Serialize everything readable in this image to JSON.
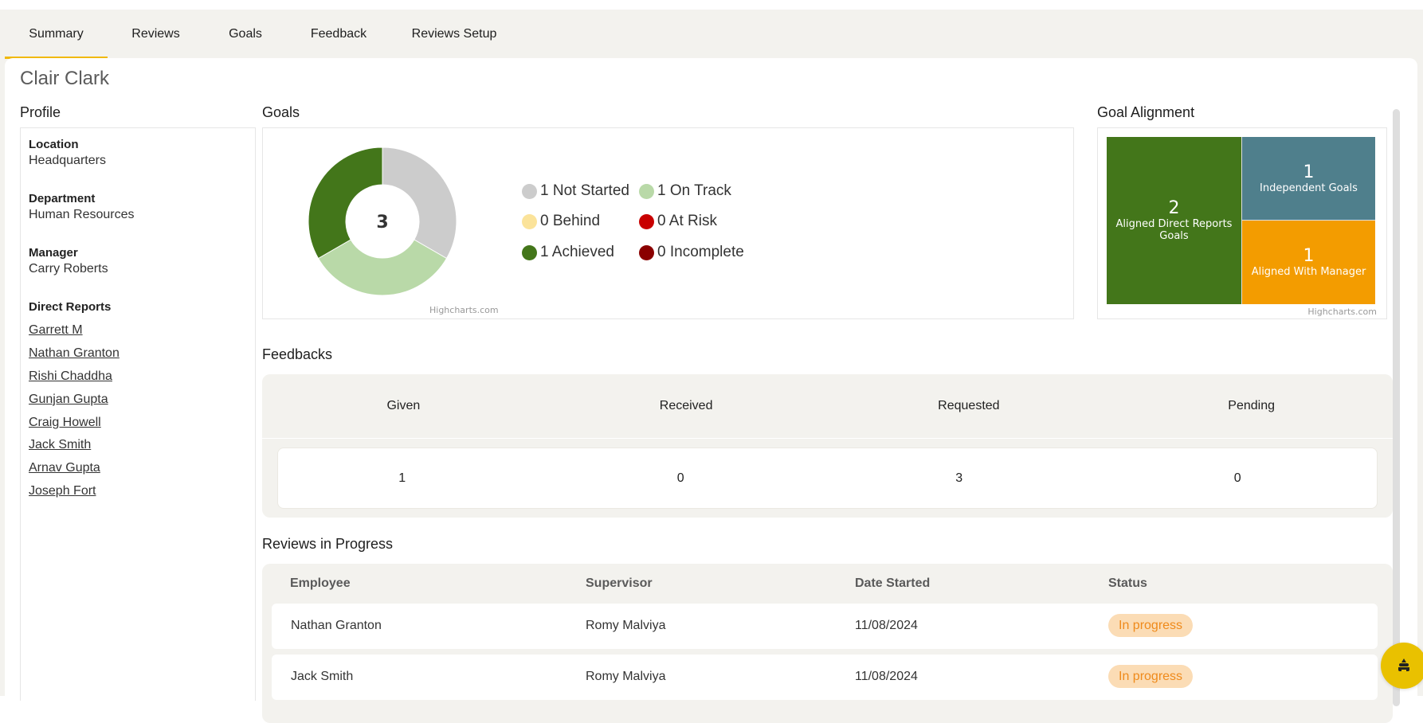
{
  "tabs": [
    {
      "label": "Summary",
      "active": true
    },
    {
      "label": "Reviews",
      "active": false
    },
    {
      "label": "Goals",
      "active": false
    },
    {
      "label": "Feedback",
      "active": false
    },
    {
      "label": "Reviews Setup",
      "active": false
    }
  ],
  "person_name": "Clair Clark",
  "profile": {
    "title": "Profile",
    "fields": [
      {
        "label": "Location",
        "value": "Headquarters"
      },
      {
        "label": "Department",
        "value": "Human Resources"
      },
      {
        "label": "Manager",
        "value": "Carry Roberts"
      }
    ],
    "direct_reports_label": "Direct Reports",
    "direct_reports": [
      "Garrett M",
      "Nathan Granton",
      "Rishi Chaddha",
      "Gunjan Gupta",
      "Craig Howell",
      "Jack Smith",
      "Arnav Gupta",
      "Joseph Fort"
    ]
  },
  "goals": {
    "title": "Goals",
    "total": "3",
    "credit": "Highcharts.com",
    "legend": [
      {
        "text": "1 Not Started",
        "color": "#cccccc"
      },
      {
        "text": "1 On Track",
        "color": "#b9d9a8"
      },
      {
        "text": "0 Behind",
        "color": "#fbe39a"
      },
      {
        "text": "0 At Risk",
        "color": "#c80000"
      },
      {
        "text": "1 Achieved",
        "color": "#43761a"
      },
      {
        "text": "0 Incomplete",
        "color": "#8a0000"
      }
    ]
  },
  "chart_data": [
    {
      "type": "pie",
      "title": "Goals",
      "center_label": "3",
      "categories": [
        "Not Started",
        "On Track",
        "Behind",
        "At Risk",
        "Achieved",
        "Incomplete"
      ],
      "values": [
        1,
        1,
        0,
        0,
        1,
        0
      ],
      "colors": [
        "#cccccc",
        "#b9d9a8",
        "#fbe39a",
        "#c80000",
        "#43761a",
        "#8a0000"
      ],
      "donut": true,
      "legend": "right"
    },
    {
      "type": "treemap",
      "title": "Goal Alignment",
      "categories": [
        "Aligned Direct Reports Goals",
        "Independent Goals",
        "Aligned With Manager"
      ],
      "values": [
        2,
        1,
        1
      ],
      "colors": [
        "#43761a",
        "#4f7f8c",
        "#f39c00"
      ]
    }
  ],
  "alignment": {
    "title": "Goal Alignment",
    "credit": "Highcharts.com",
    "cells": [
      {
        "value": "2",
        "label": "Aligned Direct Reports Goals",
        "color": "#43761a"
      },
      {
        "value": "1",
        "label": "Independent Goals",
        "color": "#4f7f8c"
      },
      {
        "value": "1",
        "label": "Aligned With Manager",
        "color": "#f39c00"
      }
    ]
  },
  "feedbacks": {
    "title": "Feedbacks",
    "columns": [
      "Given",
      "Received",
      "Requested",
      "Pending"
    ],
    "values": [
      "1",
      "0",
      "3",
      "0"
    ]
  },
  "reviews": {
    "title": "Reviews in Progress",
    "columns": [
      "Employee",
      "Supervisor",
      "Date Started",
      "Status"
    ],
    "rows": [
      {
        "employee": "Nathan Granton",
        "supervisor": "Romy Malviya",
        "date": "11/08/2024",
        "status": "In progress"
      },
      {
        "employee": "Jack Smith",
        "supervisor": "Romy Malviya",
        "date": "11/08/2024",
        "status": "In progress"
      }
    ]
  },
  "fab": {
    "icon": "bee-icon"
  }
}
